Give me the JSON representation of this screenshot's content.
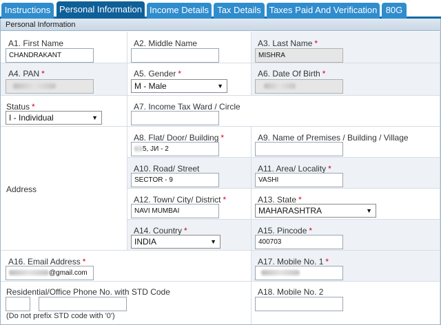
{
  "tabs": [
    {
      "label": "Instructions",
      "active": false
    },
    {
      "label": "Personal Information",
      "active": true
    },
    {
      "label": "Income Details",
      "active": false
    },
    {
      "label": "Tax Details",
      "active": false
    },
    {
      "label": "Taxes Paid And Verification",
      "active": false
    },
    {
      "label": "80G",
      "active": false
    }
  ],
  "section_title": "Personal Information",
  "fields": {
    "first_name": {
      "label": "A1. First Name",
      "value": "CHANDRAKANT"
    },
    "middle_name": {
      "label": "A2. Middle Name",
      "value": ""
    },
    "last_name": {
      "label": "A3. Last Name",
      "required": "*",
      "value": "MISHRA"
    },
    "pan": {
      "label": "A4. PAN",
      "required": "*"
    },
    "gender": {
      "label": "A5. Gender",
      "required": "*",
      "value": "M - Male"
    },
    "dob": {
      "label": "A6. Date Of Birth",
      "required": "*"
    },
    "status": {
      "label": "Status",
      "required": "*",
      "value": "I - Individual"
    },
    "ward": {
      "label": "A7. Income Tax Ward / Circle",
      "value": ""
    },
    "address_label": "Address",
    "flat": {
      "label": "A8. Flat/ Door/ Building",
      "required": "*",
      "value_suffix": "5, JИ - 2"
    },
    "premises": {
      "label": "A9. Name of Premises / Building / Village",
      "value": ""
    },
    "road": {
      "label": "A10. Road/ Street",
      "value": "SECTOR - 9"
    },
    "area": {
      "label": "A11. Area/ Locality",
      "required": "*",
      "value": "VASHI"
    },
    "city": {
      "label": "A12. Town/ City/ District",
      "required": "*",
      "value": "NAVI MUMBAI"
    },
    "state": {
      "label": "A13. State",
      "required": "*",
      "value": "MAHARASHTRA"
    },
    "country": {
      "label": "A14. Country",
      "required": "*",
      "value": "INDIA"
    },
    "pincode": {
      "label": "A15. Pincode",
      "required": "*",
      "value": "400703"
    },
    "email": {
      "label": "A16. Email Address",
      "required": "*",
      "value_suffix": "@gmail.com"
    },
    "mobile1": {
      "label": "A17. Mobile No. 1",
      "required": "*"
    },
    "phone": {
      "label": "Residential/Office Phone No. with STD Code",
      "note": "(Do not prefix STD code with '0')"
    },
    "mobile2": {
      "label": "A18. Mobile No. 2",
      "value": ""
    }
  },
  "icons": {
    "dropdown": "▼"
  }
}
